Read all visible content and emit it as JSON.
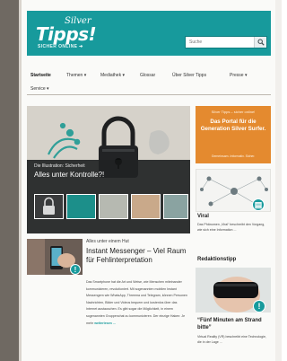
{
  "header": {
    "logo_top": "Silver",
    "logo_main": "Tipps!",
    "logo_sub": "SICHER ONLINE ➔",
    "search_placeholder": "Suche",
    "brand_color": "#179a9c"
  },
  "nav": {
    "items": [
      {
        "label": "Startseite",
        "active": true
      },
      {
        "label": "Themen ▾"
      },
      {
        "label": "Mediathek ▾"
      },
      {
        "label": "Glossar"
      },
      {
        "label": "Über Silver Tipps"
      },
      {
        "label": "Presse ▾"
      },
      {
        "label": "Service ▾"
      }
    ]
  },
  "hero": {
    "kicker": "Die Illustration: Sicherheit",
    "title": "Alles unter Kontrolle?!"
  },
  "article": {
    "kicker": "Alles unter einem Hut",
    "title": "Instant Messenger – Viel Raum für Fehlinterpretation",
    "body": "Das Smartphone hat die Art und Weise, wie Menschen miteinander kommunizieren, revolutioniert. Mit sogenannten mobilen Instant Messengern wie WhatsApp, Threema und Telegram, können Personen Nachrichten, Bilder und Videos bequem und kostenlos über das Internet austauschen. Es gibt sogar die Möglichkeit, in einem sogenannten Gruppenchat zu kommunizieren. Der einzige Haken: Je mehr",
    "more": "weiterlesen ..."
  },
  "sidebar": {
    "promo_top": "Silver Tipps – sicher online!",
    "promo_title": "Das Portal für die Generation Silver Surfer.",
    "promo_bottom": "Gemeinsam. Informativ. Sicher.",
    "viral_title": "Viral",
    "viral_text": "Das Phänomen „Viral“ beschreibt den Vorgang, wie sich eine Information ...",
    "redaktion_title": "Redaktionstipp",
    "redaktion_quote": "“Fünf Minuten am Strand bitte”",
    "redaktion_text": "Virtual Reality (VR) beschreibt eine Technologie, die in der Lage ..."
  }
}
